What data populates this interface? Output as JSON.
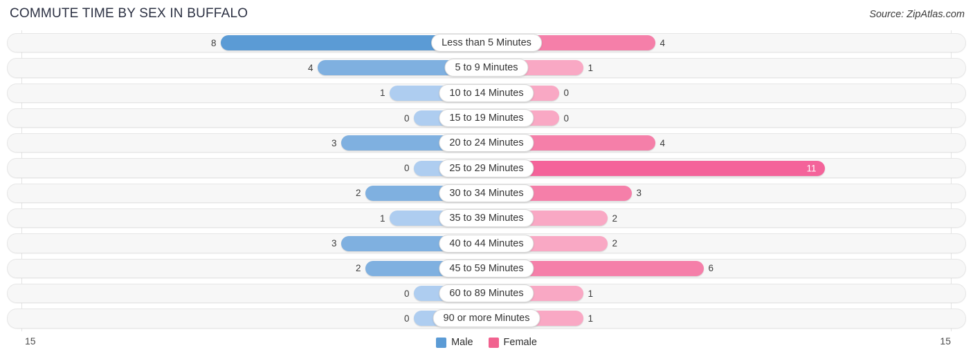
{
  "header": {
    "title": "COMMUTE TIME BY SEX IN BUFFALO",
    "source": "Source: ZipAtlas.com"
  },
  "axis": {
    "min_label": "15",
    "max_label": "15",
    "max_value": 15
  },
  "legend": [
    {
      "label": "Male",
      "color": "#5b9bd5",
      "name": "legend-item-male"
    },
    {
      "label": "Female",
      "color": "#f1628f",
      "name": "legend-item-female"
    }
  ],
  "colors": {
    "male_strong": "#5b9bd5",
    "male_mid": "#7fb0e0",
    "male_light": "#aecdf0",
    "female_strong": "#f4639a",
    "female_mid": "#f57fa9",
    "female_light": "#f9a8c4",
    "track": "#f7f7f7",
    "gridline": "#e3e3e3"
  },
  "chart_data": {
    "type": "bar",
    "title": "COMMUTE TIME BY SEX IN BUFFALO",
    "subtitle": "Source: ZipAtlas.com",
    "orientation": "horizontal-diverging",
    "xlabel": "",
    "ylabel": "",
    "xlim": [
      15,
      15
    ],
    "grid": false,
    "legend_position": "bottom-center",
    "categories": [
      "Less than 5 Minutes",
      "5 to 9 Minutes",
      "10 to 14 Minutes",
      "15 to 19 Minutes",
      "20 to 24 Minutes",
      "25 to 29 Minutes",
      "30 to 34 Minutes",
      "35 to 39 Minutes",
      "40 to 44 Minutes",
      "45 to 59 Minutes",
      "60 to 89 Minutes",
      "90 or more Minutes"
    ],
    "series": [
      {
        "name": "Male",
        "values": [
          8,
          4,
          1,
          0,
          3,
          0,
          2,
          1,
          3,
          2,
          0,
          0
        ]
      },
      {
        "name": "Female",
        "values": [
          4,
          1,
          0,
          0,
          4,
          11,
          3,
          2,
          2,
          6,
          1,
          1
        ]
      }
    ]
  },
  "rows": [
    {
      "category": "Less than 5 Minutes",
      "male": "8",
      "female": "4",
      "male_v": 8,
      "female_v": 4,
      "female_inside": false
    },
    {
      "category": "5 to 9 Minutes",
      "male": "4",
      "female": "1",
      "male_v": 4,
      "female_v": 1,
      "female_inside": false
    },
    {
      "category": "10 to 14 Minutes",
      "male": "1",
      "female": "0",
      "male_v": 1,
      "female_v": 0,
      "female_inside": false
    },
    {
      "category": "15 to 19 Minutes",
      "male": "0",
      "female": "0",
      "male_v": 0,
      "female_v": 0,
      "female_inside": false
    },
    {
      "category": "20 to 24 Minutes",
      "male": "3",
      "female": "4",
      "male_v": 3,
      "female_v": 4,
      "female_inside": false
    },
    {
      "category": "25 to 29 Minutes",
      "male": "0",
      "female": "11",
      "male_v": 0,
      "female_v": 11,
      "female_inside": true
    },
    {
      "category": "30 to 34 Minutes",
      "male": "2",
      "female": "3",
      "male_v": 2,
      "female_v": 3,
      "female_inside": false
    },
    {
      "category": "35 to 39 Minutes",
      "male": "1",
      "female": "2",
      "male_v": 1,
      "female_v": 2,
      "female_inside": false
    },
    {
      "category": "40 to 44 Minutes",
      "male": "3",
      "female": "2",
      "male_v": 3,
      "female_v": 2,
      "female_inside": false
    },
    {
      "category": "45 to 59 Minutes",
      "male": "2",
      "female": "6",
      "male_v": 2,
      "female_v": 6,
      "female_inside": false
    },
    {
      "category": "60 to 89 Minutes",
      "male": "0",
      "female": "1",
      "male_v": 0,
      "female_v": 1,
      "female_inside": false
    },
    {
      "category": "90 or more Minutes",
      "male": "0",
      "female": "1",
      "male_v": 0,
      "female_v": 1,
      "female_inside": false
    }
  ]
}
